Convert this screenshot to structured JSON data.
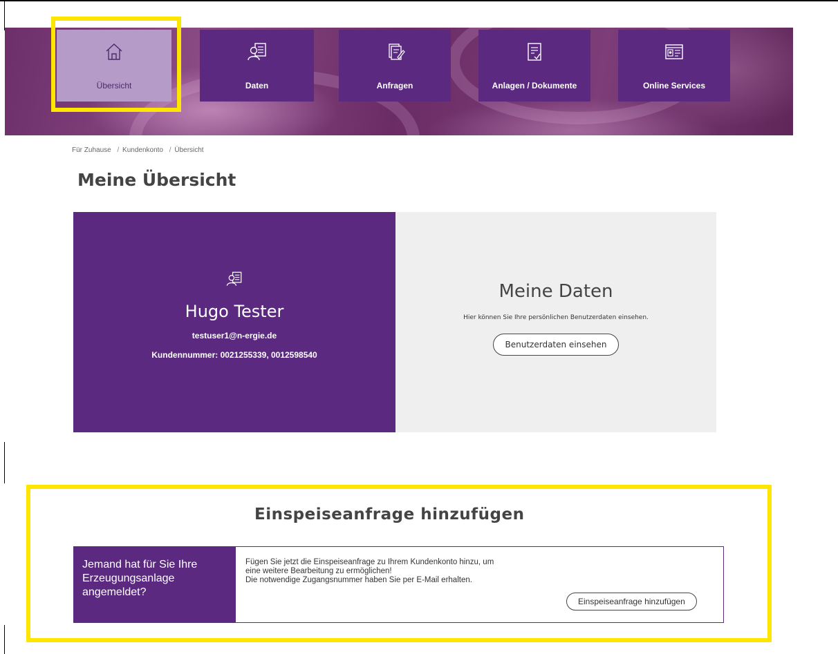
{
  "nav": {
    "tiles": [
      {
        "label": "Übersicht",
        "icon": "home-icon",
        "active": true
      },
      {
        "label": "Daten",
        "icon": "user-card-icon",
        "active": false
      },
      {
        "label": "Anfragen",
        "icon": "edit-document-icon",
        "active": false
      },
      {
        "label": "Anlagen / Dokumente",
        "icon": "checklist-document-icon",
        "active": false
      },
      {
        "label": "Online Services",
        "icon": "browser-window-icon",
        "active": false
      }
    ]
  },
  "breadcrumb": [
    "Für Zuhause",
    "Kundenkonto",
    "Übersicht"
  ],
  "breadcrumb_separator": "/",
  "page_title": "Meine Übersicht",
  "profile": {
    "icon": "user-card-icon",
    "name": "Hugo Tester",
    "email": "testuser1@n-ergie.de",
    "customer_numbers": "Kundennummer: 0021255339, 0012598540"
  },
  "my_data": {
    "title": "Meine Daten",
    "text": "Hier können Sie Ihre persönlichen Benutzerdaten einsehen.",
    "button": "Benutzerdaten einsehen"
  },
  "feed_in": {
    "title": "Einspeiseanfrage hinzufügen",
    "side_lines": [
      "Jemand hat für Sie Ihre",
      "Erzeugungsanlage",
      "angemeldet?"
    ],
    "text_lines": [
      "Fügen Sie jetzt die Einspeiseanfrage zu Ihrem Kundenkonto hinzu, um",
      "eine weitere Bearbeitung zu ermöglichen!",
      "Die notwendige Zugangsnummer haben Sie per E-Mail erhalten."
    ],
    "button": "Einspeiseanfrage hinzufügen"
  },
  "colors": {
    "primary_purple": "#5b2a80",
    "active_tile": "#b59cc8",
    "highlight_yellow": "#ffe600",
    "card_grey": "#efefef"
  }
}
